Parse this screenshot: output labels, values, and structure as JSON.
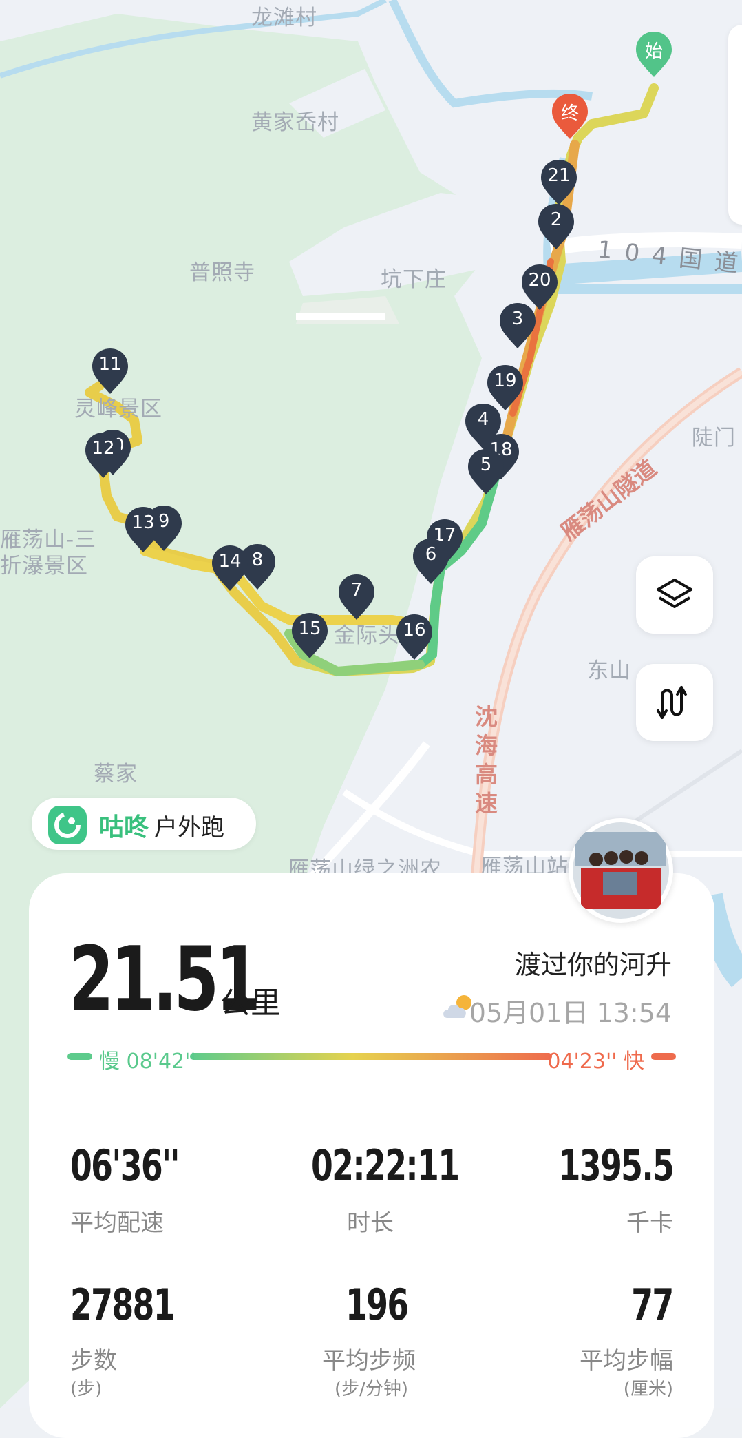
{
  "map": {
    "labels": [
      "龙滩村",
      "黄家岙村",
      "普照寺",
      "坑下庄",
      "灵峰景区",
      "雁荡山-三",
      "折瀑景区",
      "东山",
      "蔡家",
      "陡门",
      "金际头",
      "雁荡山绿之洲农",
      "雁荡山站"
    ],
    "roads": {
      "highway_name": "104国道",
      "tunnel": "雁荡山隧道",
      "expressway": "沈海高速"
    },
    "start_marker": "始",
    "end_marker": "终",
    "km_markers": [
      "21",
      "2",
      "20",
      "3",
      "19",
      "4",
      "18",
      "5",
      "17",
      "6",
      "16",
      "15",
      "7",
      "8",
      "14",
      "9",
      "13",
      "10",
      "12",
      "11"
    ]
  },
  "map_controls": {
    "layers_icon": "layers-icon",
    "route_icon": "route-icon"
  },
  "brand": {
    "name": "咕咚",
    "activity": "户外跑"
  },
  "summary": {
    "distance": "21.51",
    "distance_unit": "公里",
    "user_name": "渡过你的河升",
    "datetime": "05月01日 13:54",
    "weather_icon": "partly-cloudy-icon"
  },
  "pace_legend": {
    "slow_label": "慢 08'42''",
    "fast_label": "04'23'' 快",
    "slow_color": "#5dcb8c",
    "fast_color": "#ee6b4d"
  },
  "stats": [
    {
      "value": "06'36''",
      "label": "平均配速",
      "unit": ""
    },
    {
      "value": "02:22:11",
      "label": "时长",
      "unit": ""
    },
    {
      "value": "1395.5",
      "label": "千卡",
      "unit": ""
    },
    {
      "value": "27881",
      "label": "步数",
      "unit": "(步)"
    },
    {
      "value": "196",
      "label": "平均步频",
      "unit": "(步/分钟)"
    },
    {
      "value": "77",
      "label": "平均步幅",
      "unit": "(厘米)"
    }
  ]
}
